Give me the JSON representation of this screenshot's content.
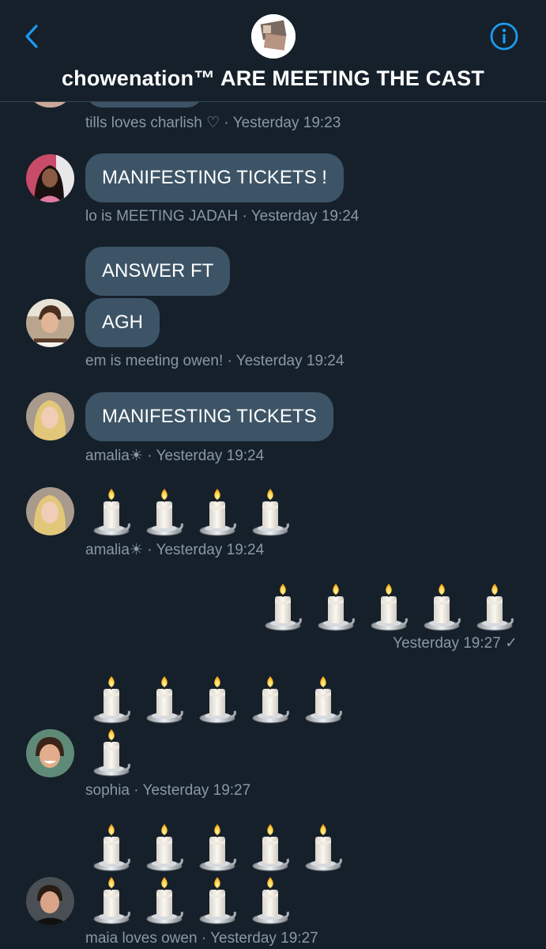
{
  "header": {
    "title": "chowenation™ ARE MEETING THE CAST",
    "back_icon": "chevron-left-icon",
    "info_icon": "info-icon"
  },
  "colors": {
    "background": "#15202b",
    "bubble": "#3d5466",
    "accent": "#1d9bf0",
    "meta": "#8899a6"
  },
  "messages": [
    {
      "sender": "tills loves charlish ♡",
      "time": "Yesterday 19:23"
    },
    {
      "sender": "lo is MEETING JADAH",
      "text": "MANIFESTING TICKETS !",
      "time": "Yesterday 19:24"
    },
    {
      "sender": "em is meeting owen!",
      "texts": [
        "ANSWER FT",
        "AGH"
      ],
      "time": "Yesterday 19:24"
    },
    {
      "sender": "amalia☀",
      "text": "MANIFESTING TICKETS",
      "time": "Yesterday 19:24"
    },
    {
      "sender": "amalia☀",
      "emoji": "candle ×4",
      "time": "Yesterday 19:24"
    },
    {
      "sender": "",
      "emoji": "candle ×5",
      "time": "Yesterday 19:27",
      "status_icon": "checkmark-icon"
    },
    {
      "sender": "sophia",
      "emoji": "candle ×6",
      "time": "Yesterday 19:27"
    },
    {
      "sender": "maia loves owen",
      "emoji": "candle ×9",
      "time": "Yesterday 19:27"
    }
  ],
  "separator": "·",
  "sent_check": "✓"
}
